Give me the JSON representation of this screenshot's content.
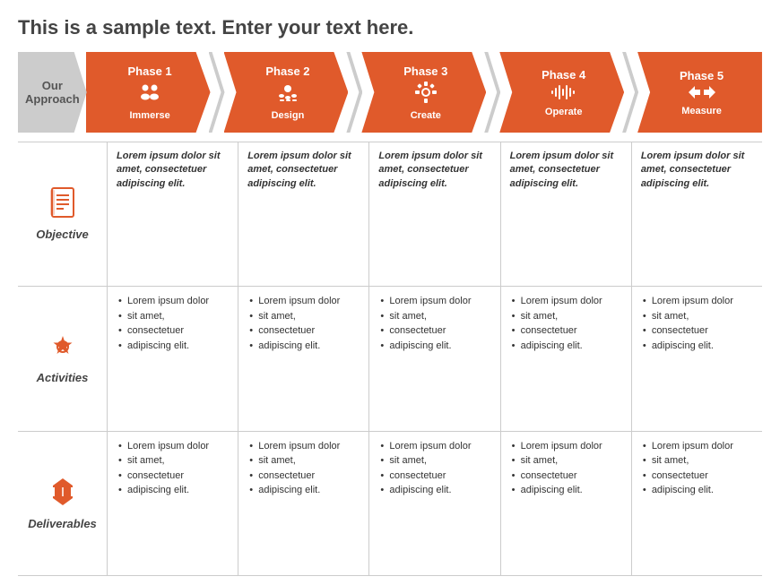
{
  "title": "This is a sample text. Enter your text here.",
  "approach_label": "Our\nApproach",
  "phases": [
    {
      "num": "Phase 1",
      "name": "Immerse",
      "icon": "👥"
    },
    {
      "num": "Phase 2",
      "name": "Design",
      "icon": "🎨"
    },
    {
      "num": "Phase 3",
      "name": "Create",
      "icon": "⚙️"
    },
    {
      "num": "Phase 4",
      "name": "Operate",
      "icon": "📊"
    },
    {
      "num": "Phase 5",
      "name": "Measure",
      "icon": "◁▷"
    }
  ],
  "rows": [
    {
      "label": "Objective",
      "icon_type": "list",
      "type": "objective",
      "cells": [
        "Lorem ipsum dolor sit amet, consectetuer adipiscing elit.",
        "Lorem ipsum dolor sit amet, consectetuer adipiscing elit.",
        "Lorem ipsum dolor sit amet, consectetuer adipiscing elit.",
        "Lorem ipsum dolor sit amet, consectetuer adipiscing elit.",
        "Lorem ipsum dolor sit amet, consectetuer adipiscing elit."
      ]
    },
    {
      "label": "Activities",
      "icon_type": "star",
      "type": "bullets",
      "cells": [
        [
          "Lorem ipsum dolor",
          "sit amet,",
          "consectetuer",
          "adipiscing elit."
        ],
        [
          "Lorem ipsum dolor",
          "sit amet,",
          "consectetuer",
          "adipiscing elit."
        ],
        [
          "Lorem ipsum dolor",
          "sit amet,",
          "consectetuer",
          "adipiscing elit."
        ],
        [
          "Lorem ipsum dolor",
          "sit amet,",
          "consectetuer",
          "adipiscing elit."
        ],
        [
          "Lorem ipsum dolor",
          "sit amet,",
          "consectetuer",
          "adipiscing elit."
        ]
      ]
    },
    {
      "label": "Deliverables",
      "icon_type": "hourglass",
      "type": "bullets",
      "cells": [
        [
          "Lorem ipsum dolor",
          "sit amet,",
          "consectetuer",
          "adipiscing elit."
        ],
        [
          "Lorem ipsum dolor",
          "sit amet,",
          "consectetuer",
          "adipiscing elit."
        ],
        [
          "Lorem ipsum dolor",
          "sit amet,",
          "consectetuer",
          "adipiscing elit."
        ],
        [
          "Lorem ipsum dolor",
          "sit amet,",
          "consectetuer",
          "adipiscing elit."
        ],
        [
          "Lorem ipsum dolor",
          "sit amet,",
          "consectetuer",
          "adipiscing elit."
        ]
      ]
    }
  ],
  "colors": {
    "orange": "#e05a2b",
    "gray": "#b0b0b0",
    "dark_gray": "#555555"
  }
}
